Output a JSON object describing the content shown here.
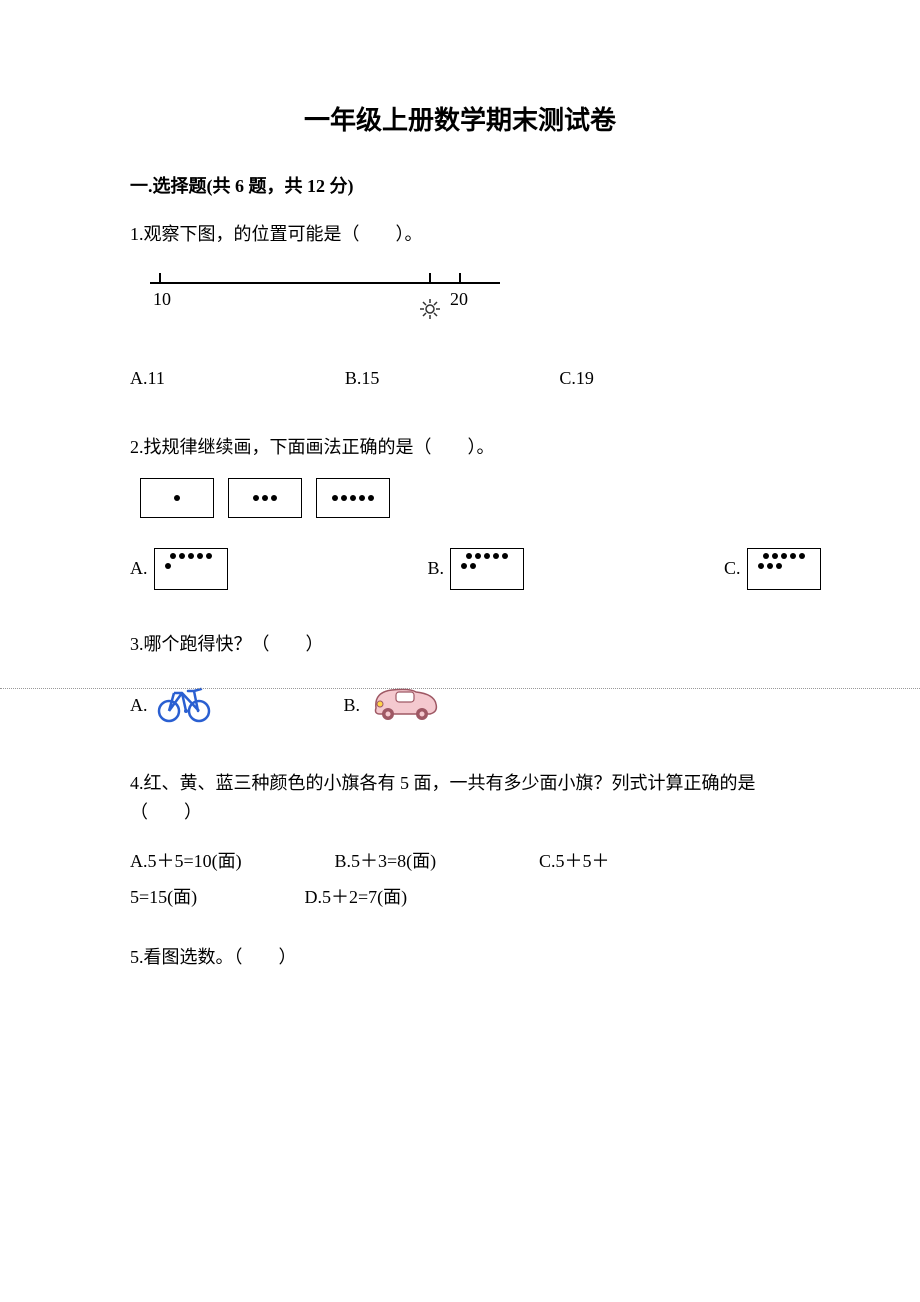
{
  "title": "一年级上册数学期末测试卷",
  "section": {
    "label": "一.选择题(共 6 题，共 12 分)"
  },
  "q1": {
    "text": "1.观察下图，的位置可能是（　　）。",
    "tick_left": "10",
    "tick_right": "20",
    "optA": "A.11",
    "optB": "B.15",
    "optC": "C.19"
  },
  "q2": {
    "text": "2.找规律继续画，下面画法正确的是（　　）。",
    "optA": "A.",
    "optB": "B.",
    "optC": "C."
  },
  "q3": {
    "text": "3.哪个跑得快？（　　）",
    "optA": "A.",
    "optB": "B."
  },
  "q4": {
    "text": "4.红、黄、蓝三种颜色的小旗各有 5 面，一共有多少面小旗？列式计算正确的是（　　）",
    "optA": "A.5＋5=10(面)",
    "optB": "B.5＋3=8(面)",
    "optC_prefix": "C.5＋5＋",
    "optC_suffix": "5=15(面)",
    "optD": "D.5＋2=7(面)"
  },
  "q5": {
    "text": "5.看图选数。（　　）"
  }
}
